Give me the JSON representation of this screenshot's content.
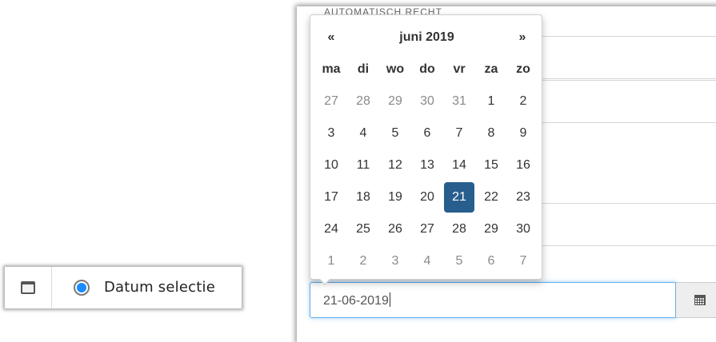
{
  "left_panel": {
    "radio_label": "Datum selectie",
    "radio_checked": true,
    "icon": "calendar-icon"
  },
  "form": {
    "top_label": "AUTOMATISCH RECHT",
    "date_value": "21-06-2019",
    "addon_icon": "calendar-icon"
  },
  "datepicker": {
    "prev": "«",
    "next": "»",
    "month_title": "juni 2019",
    "weekdays": [
      "ma",
      "di",
      "wo",
      "do",
      "vr",
      "za",
      "zo"
    ],
    "weeks": [
      [
        "27",
        "28",
        "29",
        "30",
        "31",
        "1",
        "2"
      ],
      [
        "3",
        "4",
        "5",
        "6",
        "7",
        "8",
        "9"
      ],
      [
        "10",
        "11",
        "12",
        "13",
        "14",
        "15",
        "16"
      ],
      [
        "17",
        "18",
        "19",
        "20",
        "21",
        "22",
        "23"
      ],
      [
        "24",
        "25",
        "26",
        "27",
        "28",
        "29",
        "30"
      ],
      [
        "1",
        "2",
        "3",
        "4",
        "5",
        "6",
        "7"
      ]
    ],
    "muted_days": [
      "0.0",
      "0.1",
      "0.2",
      "0.3",
      "0.4",
      "5.0",
      "5.1",
      "5.2",
      "5.3",
      "5.4",
      "5.5",
      "5.6"
    ],
    "selected_day": "3.4",
    "selected_color": "#285e8e"
  }
}
